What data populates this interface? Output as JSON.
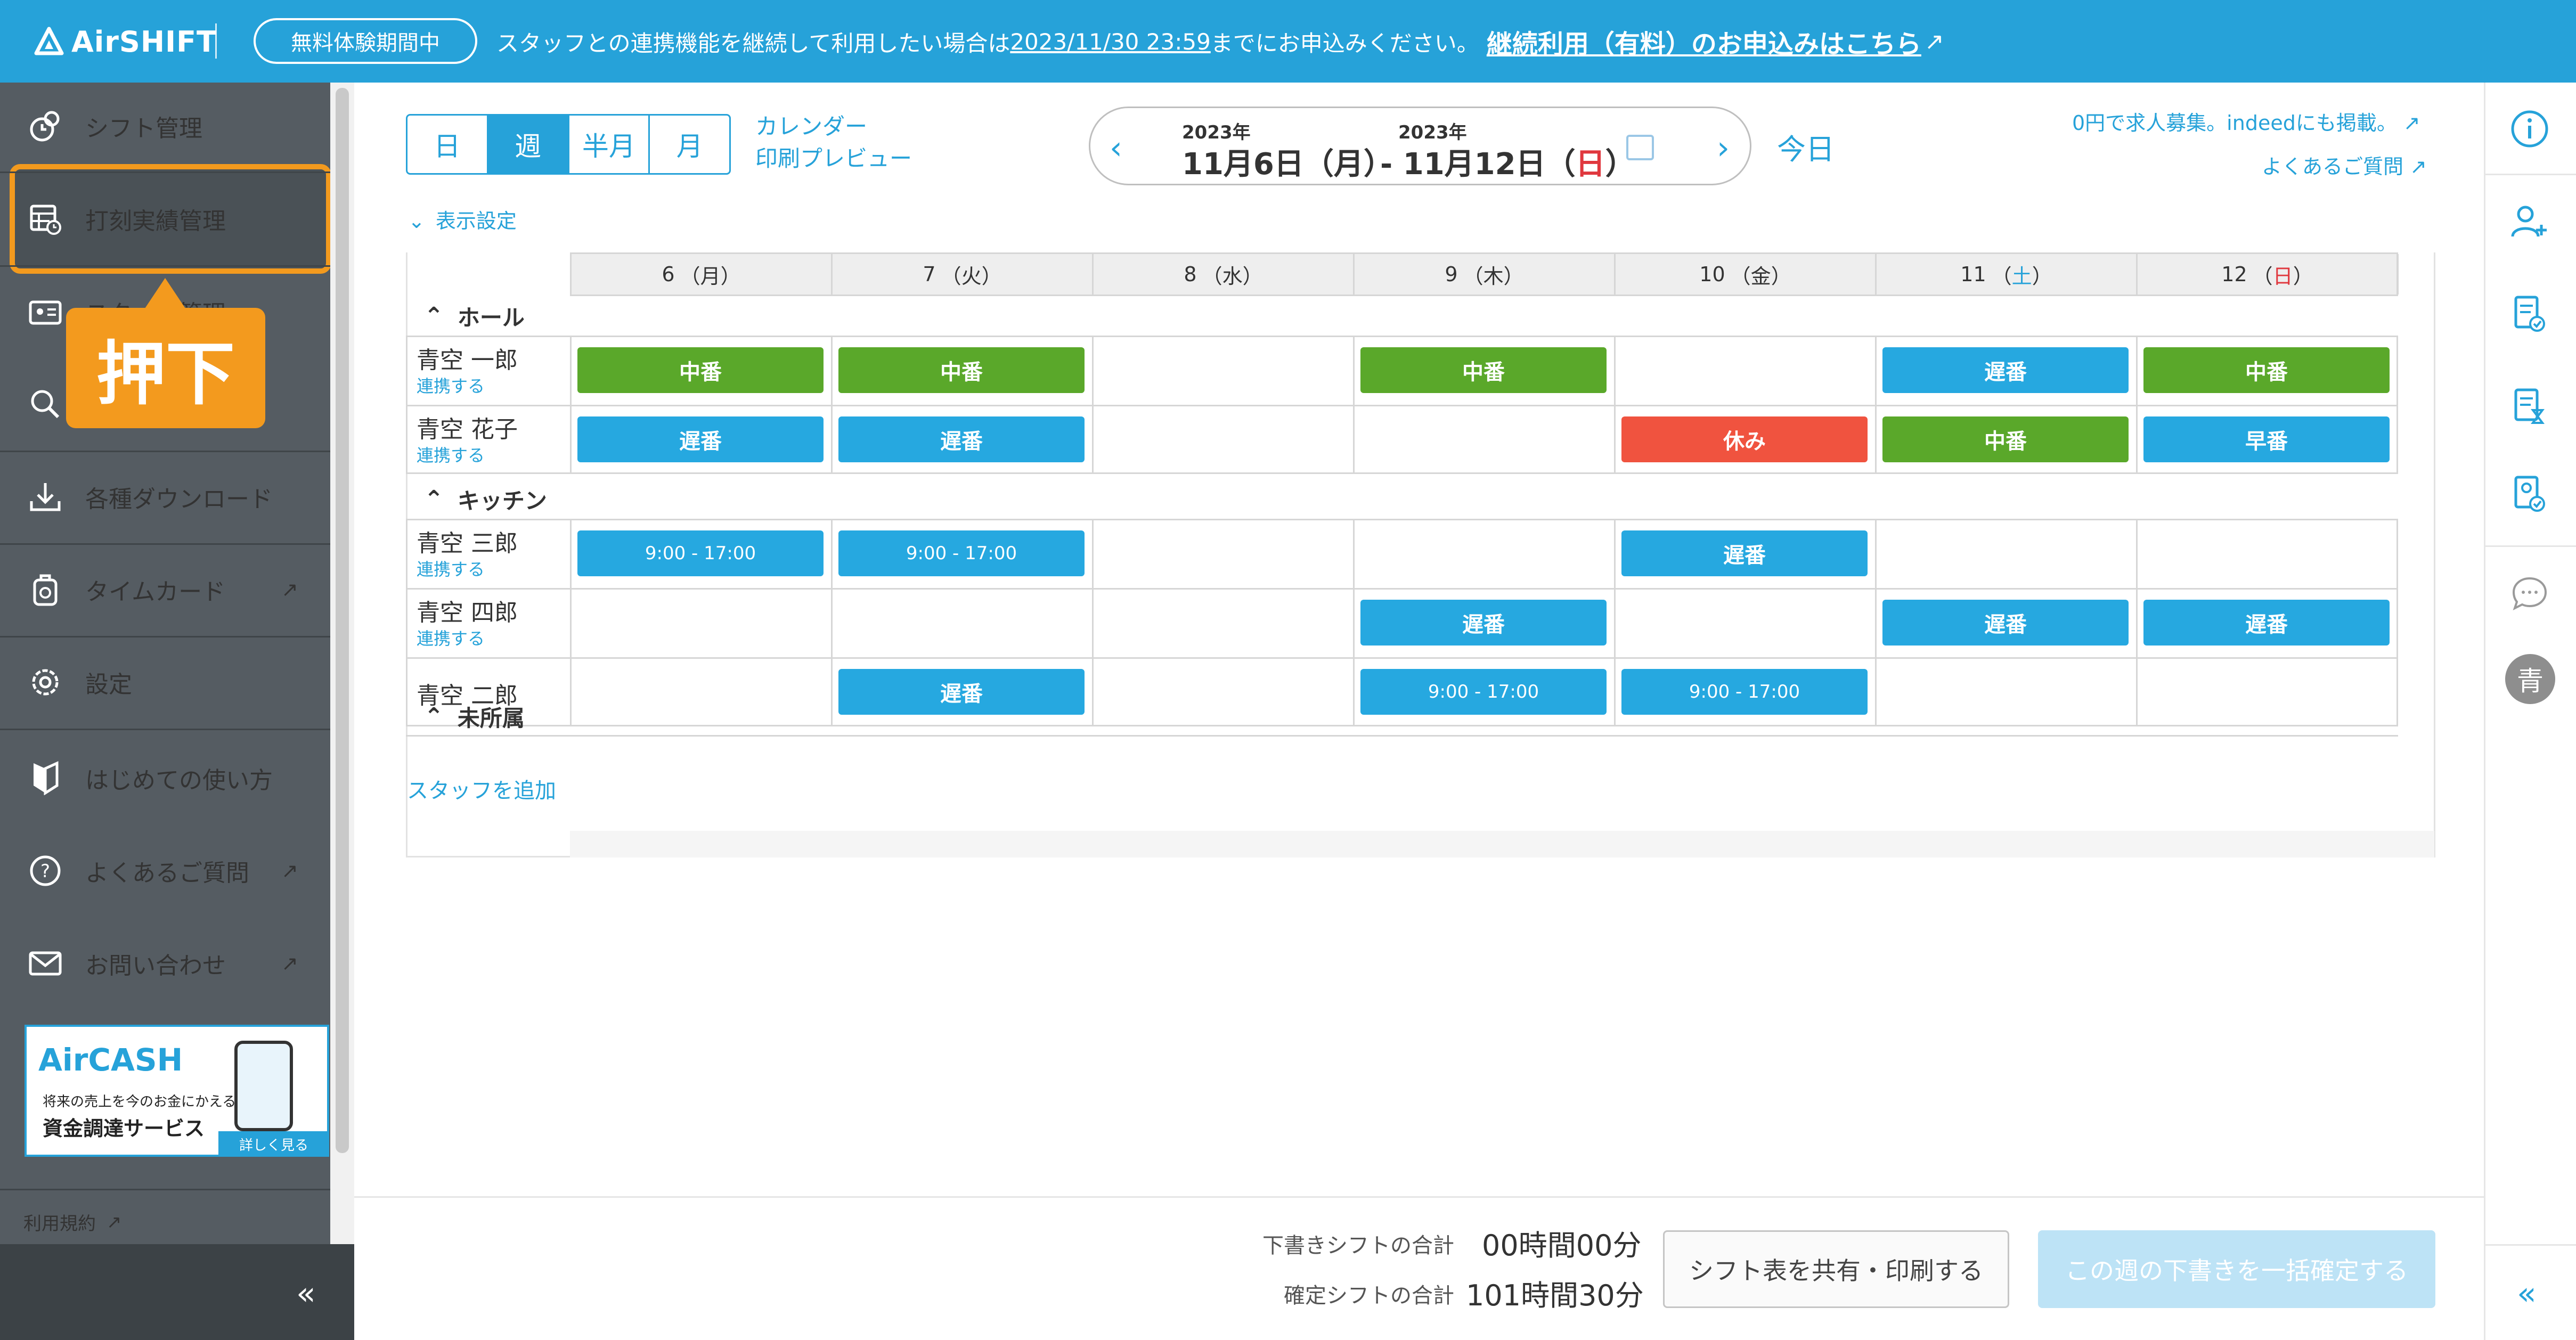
{
  "colors": {
    "brand": "#26a2d9",
    "sidebar": "#555c62",
    "highlight": "#f39a1e",
    "green_shift": "#5aa82a",
    "blue_shift": "#26a8e0",
    "red_shift": "#f0533f"
  },
  "banner": {
    "logo_text": "AirSHIFT",
    "trial_badge": "無料体験期間中",
    "message_pre": "スタッフとの連携機能を継続して利用したい場合は",
    "message_date": "2023/11/30 23:59",
    "message_post": "までにお申込みください。",
    "link_label": "継続利用（有料）のお申込みはこちら"
  },
  "sidebar": {
    "items": [
      {
        "label": "シフト管理",
        "icon": "shift-icon"
      },
      {
        "label": "打刻実績管理",
        "icon": "timesheet-icon"
      },
      {
        "label": "スタッフ管理",
        "icon": "staff-card-icon"
      },
      {
        "label": "",
        "icon": "search-user-icon"
      },
      {
        "label": "各種ダウンロード",
        "icon": "download-icon"
      },
      {
        "label": "タイムカード",
        "icon": "timecard-icon",
        "external": true
      },
      {
        "label": "設定",
        "icon": "gear-icon"
      },
      {
        "label": "はじめての使い方",
        "icon": "beginner-icon"
      },
      {
        "label": "よくあるご質問",
        "icon": "question-icon",
        "external": true
      },
      {
        "label": "お問い合わせ",
        "icon": "mail-icon",
        "external": true
      }
    ],
    "callout": "押下",
    "aircash": {
      "logo": "AirCASH",
      "sub": "将来の売上を今のお金にかえる",
      "main": "資金調達サービス",
      "button": "詳しく見る"
    },
    "terms": "利用規約",
    "collapse": "«"
  },
  "header": {
    "views": [
      "日",
      "週",
      "半月",
      "月"
    ],
    "active_view": "週",
    "calendar_link_1": "カレンダー",
    "calendar_link_2": "印刷プレビュー",
    "start_year": "2023年",
    "start_date": "11月6日（月）",
    "end_year": "2023年",
    "end_prefix": "- 11月12日（",
    "end_day": "日",
    "end_suffix": "）",
    "today": "今日",
    "recruit_link": "0円で求人募集。indeedにも掲載。",
    "faq_link": "よくあるご質問",
    "display_settings": "表示設定"
  },
  "schedule": {
    "days": [
      {
        "num": "6",
        "dow": "月",
        "color": ""
      },
      {
        "num": "7",
        "dow": "火",
        "color": ""
      },
      {
        "num": "8",
        "dow": "水",
        "color": ""
      },
      {
        "num": "9",
        "dow": "木",
        "color": ""
      },
      {
        "num": "10",
        "dow": "金",
        "color": ""
      },
      {
        "num": "11",
        "dow": "土",
        "color": "#26a2d9"
      },
      {
        "num": "12",
        "dow": "日",
        "color": "#e0383e"
      }
    ],
    "sections": [
      {
        "name": "ホール",
        "staff": [
          {
            "name": "青空 一郎",
            "link": "連携する",
            "shifts": [
              [
                "中番",
                "green"
              ],
              [
                "中番",
                "green"
              ],
              null,
              [
                "中番",
                "green"
              ],
              null,
              [
                "遅番",
                "blue"
              ],
              [
                "中番",
                "green"
              ]
            ]
          },
          {
            "name": "青空 花子",
            "link": "連携する",
            "shifts": [
              [
                "遅番",
                "blue"
              ],
              [
                "遅番",
                "blue"
              ],
              null,
              null,
              [
                "休み",
                "red"
              ],
              [
                "中番",
                "green"
              ],
              [
                "早番",
                "blue"
              ]
            ]
          }
        ]
      },
      {
        "name": "キッチン",
        "staff": [
          {
            "name": "青空 三郎",
            "link": "連携する",
            "shifts": [
              [
                "9:00 - 17:00",
                "blue time"
              ],
              [
                "9:00 - 17:00",
                "blue time"
              ],
              null,
              null,
              [
                "遅番",
                "blue"
              ],
              null,
              null
            ]
          },
          {
            "name": "青空 四郎",
            "link": "連携する",
            "shifts": [
              null,
              null,
              null,
              [
                "遅番",
                "blue"
              ],
              null,
              [
                "遅番",
                "blue"
              ],
              [
                "遅番",
                "blue"
              ]
            ]
          },
          {
            "name": "青空 二郎",
            "link": "",
            "shifts": [
              null,
              [
                "遅番",
                "blue"
              ],
              null,
              [
                "9:00 - 17:00",
                "blue time"
              ],
              [
                "9:00 - 17:00",
                "blue time"
              ],
              null,
              null
            ]
          }
        ]
      },
      {
        "name": "未所属",
        "staff": []
      }
    ],
    "add_staff": "スタッフを追加"
  },
  "footer": {
    "draft_label": "下書きシフトの合計",
    "draft_value": "00時間00分",
    "confirmed_label": "確定シフトの合計",
    "confirmed_value": "101時間30分",
    "share_button": "シフト表を共有・印刷する",
    "confirm_button": "この週の下書きを一括確定する"
  },
  "rail": {
    "avatar": "青",
    "collapse": "«",
    "icons": [
      "info-icon",
      "add-user-icon",
      "doc-check-icon",
      "doc-hourglass-icon",
      "doc-approve-icon",
      "chat-icon"
    ]
  }
}
